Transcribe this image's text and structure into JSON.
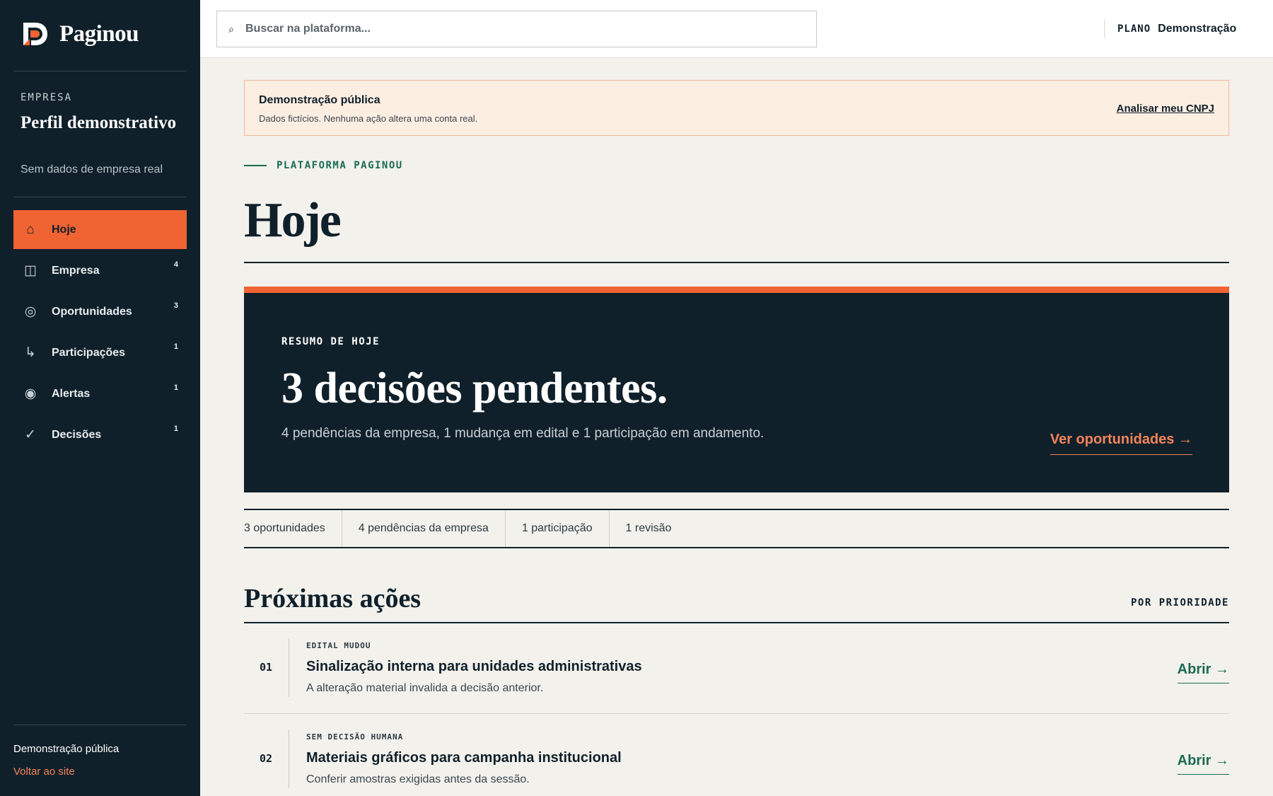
{
  "brand": {
    "name": "Paginou"
  },
  "company": {
    "kicker": "EMPRESA",
    "title": "Perfil demonstrativo",
    "subtitle": "Sem dados de empresa real"
  },
  "nav": {
    "items": [
      {
        "label": "Hoje",
        "icon": "home-icon",
        "glyph": "⌂",
        "badge": ""
      },
      {
        "label": "Empresa",
        "icon": "building-icon",
        "glyph": "◫",
        "badge": "4"
      },
      {
        "label": "Oportunidades",
        "icon": "target-icon",
        "glyph": "◎",
        "badge": "3"
      },
      {
        "label": "Participações",
        "icon": "return-arrow-icon",
        "glyph": "↳",
        "badge": "1"
      },
      {
        "label": "Alertas",
        "icon": "alert-dot-icon",
        "glyph": "◉",
        "badge": "1"
      },
      {
        "label": "Decisões",
        "icon": "check-icon",
        "glyph": "✓",
        "badge": "1"
      }
    ]
  },
  "sidebar_footer": {
    "title": "Demonstração pública",
    "link": "Voltar ao site"
  },
  "search": {
    "placeholder": "Buscar na plataforma..."
  },
  "plan": {
    "key": "PLANO",
    "value": "Demonstração"
  },
  "notice": {
    "title": "Demonstração pública",
    "text": "Dados fictícios. Nenhuma ação altera uma conta real.",
    "link": "Analisar meu CNPJ"
  },
  "page": {
    "kicker": "PLATAFORMA PAGINOU",
    "title": "Hoje"
  },
  "hero": {
    "kicker": "RESUMO DE HOJE",
    "title": "3 decisões pendentes.",
    "text": "4 pendências da empresa, 1 mudança em edital e 1 participação em andamento.",
    "link": "Ver oportunidades →"
  },
  "stats": [
    "3 oportunidades",
    "4 pendências da empresa",
    "1 participação",
    "1 revisão"
  ],
  "actions_section": {
    "title": "Próximas ações",
    "sort": "POR PRIORIDADE",
    "items": [
      {
        "num": "01",
        "tag": "EDITAL MUDOU",
        "title": "Sinalização interna para unidades administrativas",
        "desc": "A alteração material invalida a decisão anterior.",
        "link": "Abrir →"
      },
      {
        "num": "02",
        "tag": "SEM DECISÃO HUMANA",
        "title": "Materiais gráficos para campanha institucional",
        "desc": "Conferir amostras exigidas antes da sessão.",
        "link": "Abrir →"
      }
    ]
  },
  "colors": {
    "sidebar_bg": "#10202a",
    "accent": "#f06332",
    "green": "#1b6b52",
    "page_bg": "#f3f1ec"
  }
}
